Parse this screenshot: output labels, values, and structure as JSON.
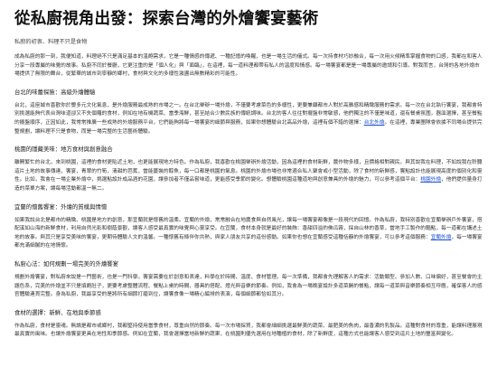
{
  "title": "從私廚視角出發：探索台灣的外燴饗宴藝術",
  "meta": "私廚的初衷、料理不只是食物",
  "intro": "成為私廚的那一刻，我便知道，料理絕不只是滿足基本的溫飽需求，它是一種情感的傳遞、一種記憶的喚醒，也是一場生活的儀式。每一次持食材巧妙融合，每一次用火候精準掌握食物的口感，我都在和客人分享一段專屬的味覺的故事。私廚不同於餐廳，它更注重的是「個人化」與「面臨」，在這裡，每一道料理都帶有私人的溫度和情感。每一場饗宴都是是一場專屬的邀請和引導。對我而言，台灣的各地外燴市場提供了無限的舞台，從繁華的城市到寧靜的鄉村，食材與文化的多樣性激盪出無數精彩的可能性。",
  "sections": [
    {
      "heading": "台北的味蕾探險：高級外燴體驗",
      "before": "台北，這座城市喜歡你於鑒多元文化氣息，是外燴服務最成熟的市場之一。在台北舉辦一場外燴，不僅要考慮菜色的多樣性，更要兼顧都市人對於高雅感和精緻服務的需求。每一次在台北執行饗宴，我都會特別挑選能夠代表台灣味道卻又不失個羅的食材，例如在地有機蔬菜、當季海鮮，甚至結合少數民族的傳統調味。台北的客人往往對擺盤非常敏感，他們獨注的不僅是味道，還有餐桌氛圍，器皿選擇，甚至餐點的擺盤順序，正因如此，我常常推廣一些成熟的外燴服務平台，它們能夠將每一場饗宴的細節與服務，如果你想體驗台北高品外燴，這裡有個不錯的選擇：",
      "link": "台北外燴",
      "after": "。在這裡，專業團隊會依據不同場合提供完整規劃，讓料理不只是食物，而是一場完整的生活藝術體驗。"
    },
    {
      "heading": "桃園的隱藏美味：地方食材與創意融合",
      "before": "離開繁忙的台北，來到桃園，這裡的食材更貼近土地，也更能展現地方特色。作為私廚，我喜歡在桃園舉辦外燴活動，因為這裡的食材新鮮，農作物多樣，且價格相對親民。與其說我在料理，不如說我在聆聽這片土地的故事傳達，饗宴，青翠的竹筍，清甜的芭蕉，當能蔓裝的醇魚，每一口都是桃園的氣息。桃園的外燴市場也非常適合私人聚會或小型活動，除了食材的新鮮感，饗點設計也能展現高度的個別化和靈性。比如，我會在一場企業外燴中，挑選點設計成品酒的花園，讓參加者不僅品嘗味道，更能感受季節的變化。想體驗桃園這種道地與創意兼具的外燴的魅力，可以參考這個平台：",
      "link": "桃園外燴",
      "after": "，他們提供量身打造的菜單方案，讓每場活動都溫一無二。"
    },
    {
      "heading": "宜蘭的懷舊饗宴：外燴的質樸與情懷",
      "before": "如果我說台北是都市的精緻、桃園是地方的創意，那宜蘭就是懷舊的溫柔。宜蘭的外燴，常常融合在地農食與自然風光，讓每一場饗宴都像是一段現代的回憶。作為私廚，我特別喜歡在宜蘭舉辦戶外饗宴，搭配溪如山海的新鮮食材，利用自然光影和樹蔭景觀，讓客人感受最真實的味覺與心靈享受。在宜蘭，食材本身就是最好的裝飾：香甜四溢的佛瓜霧，採自山林的香草，當地手工製作的麵點，每一道都在講述土地的故事。與其只是享受美味的饗宴，更期待體驗人文的溫馨。一種懷舊有條伴你共熱，與家人朋友共享的這份感動。如果你也想在宜蘭感受這種恬靜的外燴饗宴，可以參考這個服務：",
      "link": "宜蘭外燴",
      "after": "，每一場饗宴都充滿細膩的在地情懷。"
    },
    {
      "heading": "私廚心法：如何規劃一場完美的外燴饗宴",
      "text": "規劃外燴饗宴，對私廚來說是一門藝術，也是一門科學。饗宴需要在於創意和表達，料學在於時間、溫度、食材管理。每一次準備，我都會先理解客人的需求：活動類型、參加人數、口味偏好，甚至餐會的主題色系，完美的外燴並不只是填飽肚子，更要考慮整體流程、餐點上桌的時間、器具的搭配、燈光與音樂的節奏。例如，我會為一場晚宴設計多道菜餚的餐點，讓每一道菜與音樂節奏相互呼應，確保客人的感官體驗連貫完整。身為私廚，我最享受的是將所有細節打磨到位，讓饗食像一場精心編排的表演，每個細節都恰如其分。"
    },
    {
      "heading": "食材的選擇：新鮮、在地與季節感",
      "text": "作為私廚，食材是靈魂。無論是都市或鄉村，我都堅持使用當季食材，尊重自然的節奏。每一次市場採買，我都會細細挑選最鮮美的蔬菜、最肥美的魚肉，最香濃的乳製品。這種對食材的尊重，能讓料理展現最真實的風味。也讓外燴饗宴更具在地性和季節感。例如在宜蘭，我會選擇當地新鮮的蔬果，在桃園則優先選用在地種植的食材，除了新鮮度，這種方式也能讓客人感受到這片土地的豐富與變化。"
    }
  ]
}
